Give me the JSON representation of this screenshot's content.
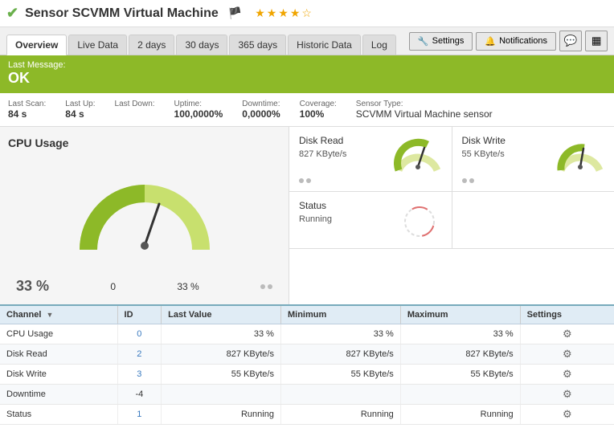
{
  "title": {
    "icon": "✔",
    "text": "Sensor SCVMM Virtual Machine",
    "flag": "🏴",
    "stars": "★★★★☆"
  },
  "tabs": [
    {
      "label": "Overview",
      "active": true
    },
    {
      "label": "Live Data",
      "active": false
    },
    {
      "label": "2 days",
      "active": false
    },
    {
      "label": "30 days",
      "active": false
    },
    {
      "label": "365 days",
      "active": false
    },
    {
      "label": "Historic Data",
      "active": false
    },
    {
      "label": "Log",
      "active": false
    }
  ],
  "actions": {
    "settings_label": "Settings",
    "notifications_label": "Notifications"
  },
  "status": {
    "label": "Last Message:",
    "value": "OK"
  },
  "info": [
    {
      "label": "Last Scan:",
      "value": "84 s"
    },
    {
      "label": "Last Up:",
      "value": "84 s"
    },
    {
      "label": "Last Down:",
      "value": ""
    },
    {
      "label": "Uptime:",
      "value": "100,0000%"
    },
    {
      "label": "Downtime:",
      "value": "0,0000%"
    },
    {
      "label": "Coverage:",
      "value": "100%"
    },
    {
      "label": "Sensor Type:",
      "value": "SCVMM Virtual Machine sensor"
    }
  ],
  "cpu": {
    "title": "CPU Usage",
    "value": "33 %",
    "min": "0",
    "max": "33 %",
    "percent": 33
  },
  "disk_read": {
    "title": "Disk Read",
    "value": "827 KByte/s",
    "gauge_percent": 60
  },
  "disk_write": {
    "title": "Disk Write",
    "value": "55 KByte/s",
    "gauge_percent": 40
  },
  "status_metric": {
    "title": "Status",
    "value": "Running"
  },
  "table": {
    "headers": [
      "Channel",
      "ID",
      "Last Value",
      "Minimum",
      "Maximum",
      "Settings"
    ],
    "rows": [
      {
        "channel": "CPU Usage",
        "id": "0",
        "last_value": "33 %",
        "minimum": "33 %",
        "maximum": "33 %"
      },
      {
        "channel": "Disk Read",
        "id": "2",
        "last_value": "827 KByte/s",
        "minimum": "827 KByte/s",
        "maximum": "827 KByte/s"
      },
      {
        "channel": "Disk Write",
        "id": "3",
        "last_value": "55 KByte/s",
        "minimum": "55 KByte/s",
        "maximum": "55 KByte/s"
      },
      {
        "channel": "Downtime",
        "id": "-4",
        "last_value": "",
        "minimum": "",
        "maximum": ""
      },
      {
        "channel": "Status",
        "id": "1",
        "last_value": "Running",
        "minimum": "Running",
        "maximum": "Running"
      }
    ]
  }
}
